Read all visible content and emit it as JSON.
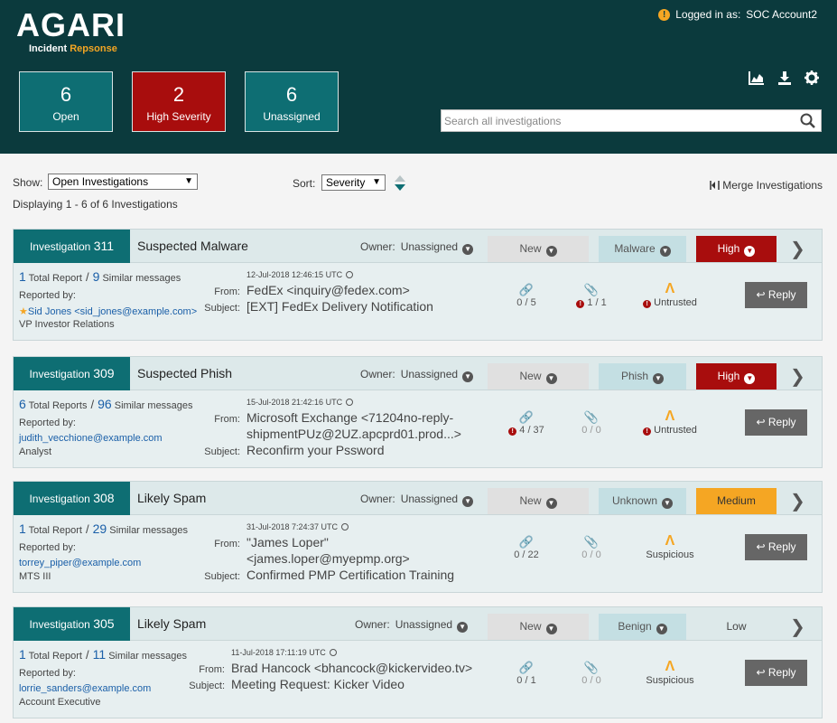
{
  "header": {
    "logo_text": "AGARI",
    "logo_sub_a": "Incident",
    "logo_sub_b": "Repsonse",
    "logged_in_label": "Logged in as:",
    "logged_in_user": "SOC Account2"
  },
  "stats": [
    {
      "value": "6",
      "label": "Open"
    },
    {
      "value": "2",
      "label": "High Severity"
    },
    {
      "value": "6",
      "label": "Unassigned"
    }
  ],
  "search": {
    "placeholder": "Search all investigations"
  },
  "filters": {
    "show_label": "Show:",
    "show_value": "Open Investigations",
    "sort_label": "Sort:",
    "sort_value": "Severity",
    "merge_label": "Merge Investigations",
    "displaying": "Displaying 1 - 6 of 6 Investigations"
  },
  "investigations": [
    {
      "prefix": "Investigation",
      "id": "311",
      "title": "Suspected Malware",
      "owner_label": "Owner:",
      "owner": "Unassigned",
      "status": "New",
      "category": "Malware",
      "severity": "High",
      "total_reports": "1",
      "total_label": "Total Report",
      "similar": "9",
      "similar_label": "Similar messages",
      "reported_by_label": "Reported by:",
      "reporter": "Sid Jones <sid_jones@example.com>",
      "role": "VP Investor Relations",
      "timestamp": "12-Jul-2018 12:46:15 UTC",
      "from_label": "From:",
      "from": "FedEx <inquiry@fedex.com>",
      "subject_label": "Subject:",
      "subject": "[EXT] FedEx Delivery Notification",
      "links": "0 / 5",
      "attachments": "1 / 1",
      "trust": "Untrusted",
      "reply": "Reply"
    },
    {
      "prefix": "Investigation",
      "id": "309",
      "title": "Suspected Phish",
      "owner_label": "Owner:",
      "owner": "Unassigned",
      "status": "New",
      "category": "Phish",
      "severity": "High",
      "total_reports": "6",
      "total_label": "Total Reports",
      "similar": "96",
      "similar_label": "Similar messages",
      "reported_by_label": "Reported by:",
      "reporter": "judith_vecchione@example.com",
      "role": "Analyst",
      "timestamp": "15-Jul-2018 21:42:16 UTC",
      "from_label": "From:",
      "from": "Microsoft Exchange <71204no-reply-",
      "from_line2": "shipmentPUz@2UZ.apcprd01.prod...>",
      "subject_label": "Subject:",
      "subject": "Reconfirm your Pssword",
      "links": "4 / 37",
      "attachments": "0 / 0",
      "trust": "Untrusted",
      "reply": "Reply"
    },
    {
      "prefix": "Investigation",
      "id": "308",
      "title": "Likely Spam",
      "owner_label": "Owner:",
      "owner": "Unassigned",
      "status": "New",
      "category": "Unknown",
      "severity": "Medium",
      "total_reports": "1",
      "total_label": "Total Report",
      "similar": "29",
      "similar_label": "Similar messages",
      "reported_by_label": "Reported by:",
      "reporter": "torrey_piper@example.com",
      "role": "MTS III",
      "timestamp": "31-Jul-2018 7:24:37  UTC",
      "from_label": "From:",
      "from": " \"James Loper\"",
      "from_line2": "<james.loper@myepmp.org>",
      "subject_label": "Subject:",
      "subject": "Confirmed PMP Certification Training",
      "links": "0 / 22",
      "attachments": "0 / 0",
      "trust": "Suspicious",
      "reply": "Reply"
    },
    {
      "prefix": "Investigation",
      "id": "305",
      "title": "Likely Spam",
      "owner_label": "Owner:",
      "owner": "Unassigned",
      "status": "New",
      "category": "Benign",
      "severity": "Low",
      "total_reports": "1",
      "total_label": "Total Report",
      "similar": "11",
      "similar_label": "Similar messages",
      "reported_by_label": "Reported by:",
      "reporter": "lorrie_sanders@example.com",
      "role": "Account Executive",
      "timestamp": "11-Jul-2018 17:11:19  UTC",
      "from_label": "From:",
      "from": "Brad Hancock <bhancock@kickervideo.tv>",
      "subject_label": "Subject:",
      "subject": "Meeting Request: Kicker Video",
      "links": "0 / 1",
      "attachments": "0 / 0",
      "trust": "Suspicious",
      "reply": "Reply"
    }
  ],
  "colors": {
    "header_bg": "#0b3a3d",
    "teal": "#0e6e73",
    "high": "#a80d0d",
    "medium": "#f5a623"
  },
  "icons": [
    "warning-icon",
    "chart-icon",
    "download-icon",
    "gear-icon",
    "search-icon",
    "merge-icon",
    "link-icon",
    "paperclip-icon",
    "error-icon",
    "agari-trust-icon",
    "reply-icon",
    "chevron-right-icon"
  ]
}
